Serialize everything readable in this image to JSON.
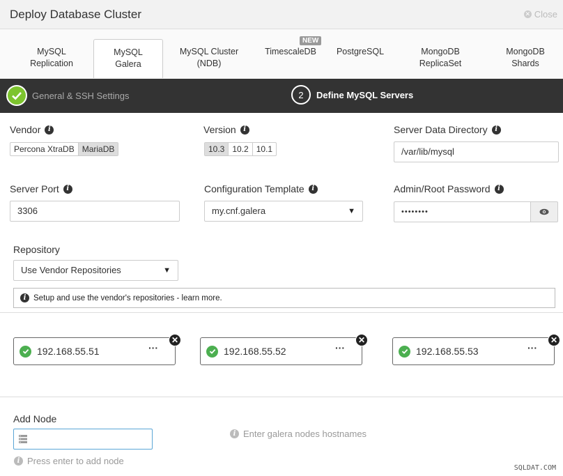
{
  "header": {
    "title": "Deploy Database Cluster",
    "close_label": "Close"
  },
  "tabs": [
    {
      "line1": "MySQL",
      "line2": "Replication"
    },
    {
      "line1": "MySQL",
      "line2": "Galera"
    },
    {
      "line1": "MySQL Cluster",
      "line2": "(NDB)"
    },
    {
      "line1": "TimescaleDB",
      "line2": ""
    },
    {
      "line1": "PostgreSQL",
      "line2": ""
    },
    {
      "line1": "MongoDB",
      "line2": "ReplicaSet"
    },
    {
      "line1": "MongoDB",
      "line2": "Shards"
    }
  ],
  "new_badge": "NEW",
  "steps": {
    "step1": "General & SSH Settings",
    "step2_num": "2",
    "step2": "Define MySQL Servers"
  },
  "vendor": {
    "label": "Vendor",
    "options": [
      "Percona XtraDB",
      "MariaDB"
    ]
  },
  "version": {
    "label": "Version",
    "options": [
      "10.3",
      "10.2",
      "10.1"
    ]
  },
  "data_dir": {
    "label": "Server Data Directory",
    "value": "/var/lib/mysql"
  },
  "port": {
    "label": "Server Port",
    "value": "3306"
  },
  "config_template": {
    "label": "Configuration Template",
    "value": "my.cnf.galera"
  },
  "password": {
    "label": "Admin/Root Password",
    "value": "••••••••"
  },
  "repository": {
    "label": "Repository",
    "value": "Use Vendor Repositories",
    "note": "Setup and use the vendor's repositories - learn more."
  },
  "nodes": [
    {
      "ip": "192.168.55.51"
    },
    {
      "ip": "192.168.55.52"
    },
    {
      "ip": "192.168.55.53"
    }
  ],
  "add_node": {
    "label": "Add Node",
    "placeholder": "",
    "hint": "Enter galera nodes hostnames",
    "help": "Press enter to add node"
  },
  "watermark": "SQLDAT.COM",
  "icons": {
    "info": "i",
    "dots": "•••",
    "close_x": "✕",
    "arrow": "▼"
  }
}
